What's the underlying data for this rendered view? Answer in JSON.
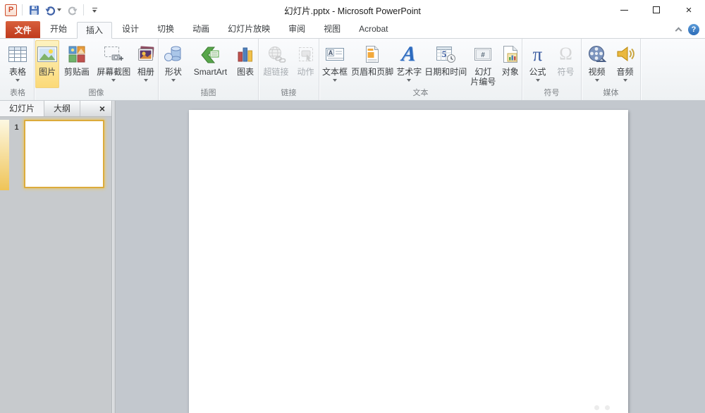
{
  "titlebar": {
    "title": "幻灯片.pptx - Microsoft PowerPoint",
    "logo_letter": "P"
  },
  "window_controls": {
    "close_glyph": "×"
  },
  "tabs": {
    "file": "文件",
    "items": [
      "开始",
      "插入",
      "设计",
      "切换",
      "动画",
      "幻灯片放映",
      "审阅",
      "视图",
      "Acrobat"
    ],
    "active": "插入"
  },
  "ribbon": {
    "groups": [
      {
        "label": "表格",
        "buttons": [
          {
            "label": "表格",
            "caret": true
          }
        ]
      },
      {
        "label": "图像",
        "buttons": [
          {
            "label": "图片",
            "highlight": true
          },
          {
            "label": "剪贴画"
          },
          {
            "label": "屏幕截图",
            "caret": true
          },
          {
            "label": "相册",
            "caret": true
          }
        ]
      },
      {
        "label": "插图",
        "buttons": [
          {
            "label": "形状",
            "caret": true
          },
          {
            "label": "SmartArt"
          },
          {
            "label": "图表"
          }
        ]
      },
      {
        "label": "链接",
        "buttons": [
          {
            "label": "超链接",
            "disabled": true
          },
          {
            "label": "动作",
            "disabled": true
          }
        ]
      },
      {
        "label": "文本",
        "buttons": [
          {
            "label": "文本框",
            "caret": true
          },
          {
            "label": "页眉和页脚"
          },
          {
            "label": "艺术字",
            "caret": true
          },
          {
            "label": "日期和时间"
          },
          {
            "label": "幻灯片编号",
            "line1": "幻灯",
            "line2": "片编号"
          },
          {
            "label": "对象"
          }
        ]
      },
      {
        "label": "符号",
        "buttons": [
          {
            "label": "公式",
            "caret": true
          },
          {
            "label": "符号",
            "disabled": true
          }
        ]
      },
      {
        "label": "媒体",
        "buttons": [
          {
            "label": "视频",
            "caret": true
          },
          {
            "label": "音频",
            "caret": true
          }
        ]
      }
    ]
  },
  "icon_glyphs": {
    "equation": "π",
    "symbol": "Ω",
    "wordart": "A",
    "textbox_letter": "A",
    "date_number": "5",
    "slide_hash": "#",
    "help": "?",
    "pane_close": "×"
  },
  "left_pane": {
    "tabs": [
      {
        "label": "幻灯片",
        "active": true
      },
      {
        "label": "大纲",
        "active": false
      }
    ],
    "slide_number": "1"
  },
  "colors": {
    "file_tab_red": "#c03a1d",
    "highlight_gold": "#fbd976",
    "selection_gold": "#dcab3c",
    "help_blue": "#2b6cb8"
  }
}
